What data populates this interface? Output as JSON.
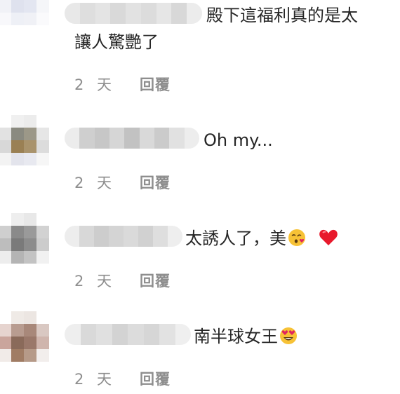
{
  "comments": [
    {
      "text_line1": "殿下這福利真的是太",
      "text_line2": "讓人驚艷了",
      "time": "2 天",
      "reply": "回覆"
    },
    {
      "text": "Oh my...",
      "time": "2 天",
      "reply": "回覆"
    },
    {
      "text": "太誘人了，美",
      "emojis": [
        "kissing-heart-emoji",
        "red-heart-emoji"
      ],
      "time": "2 天",
      "reply": "回覆"
    },
    {
      "text": "南半球女王",
      "emojis": [
        "heart-eyes-emoji"
      ],
      "time": "2 天",
      "reply": "回覆"
    }
  ]
}
